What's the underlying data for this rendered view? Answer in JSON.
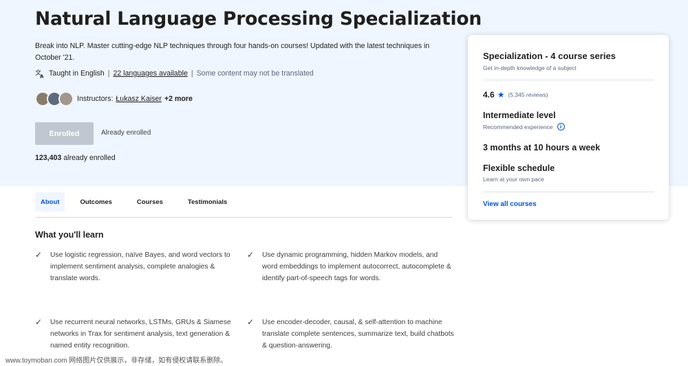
{
  "header": {
    "title": "Natural Language Processing Specialization",
    "description": "Break into NLP. Master cutting-edge NLP techniques through four hands-on courses! Updated with the latest techniques in October '21.",
    "taught_in": "Taught in English",
    "languages_link": "22 languages available",
    "translation_note": "Some content may not be translated",
    "instructors_label": "Instructors:",
    "instructor_name": "Łukasz Kaiser",
    "instructors_more": "+2 more",
    "enroll_button": "Enrolled",
    "enroll_status": "Already enrolled",
    "enrolled_count": "123,403",
    "enrolled_suffix": "already enrolled"
  },
  "card": {
    "series_title": "Specialization - 4 course series",
    "series_sub": "Get in-depth knowledge of a subject",
    "rating": "4.6",
    "reviews": "(5,345 reviews)",
    "level": "Intermediate level",
    "level_sub": "Recommended experience",
    "duration": "3 months at 10 hours a week",
    "schedule": "Flexible schedule",
    "schedule_sub": "Learn at your own pace",
    "view_all": "View all courses"
  },
  "tabs": [
    {
      "label": "About"
    },
    {
      "label": "Outcomes"
    },
    {
      "label": "Courses"
    },
    {
      "label": "Testimonials"
    }
  ],
  "learn": {
    "title": "What you'll learn",
    "items": [
      "Use logistic regression, naïve Bayes, and word vectors to implement sentiment analysis, complete analogies & translate words.",
      "Use dynamic programming, hidden Markov models, and word embeddings to implement autocorrect, autocomplete & identify part-of-speech tags for words.",
      "Use recurrent neural networks, LSTMs, GRUs & Siamese networks in Trax for sentiment analysis, text generation & named entity recognition.",
      "Use encoder-decoder, causal, & self-attention to machine translate complete sentences, summarize text, build chatbots & question-answering."
    ]
  },
  "watermark": "www.toymoban.com 网络图片仅供展示，非存储，如有侵权请联系删除。",
  "colors": {
    "hero_bg": "#f0f6ff",
    "accent": "#0056d2",
    "disabled_button": "#c1c7d0"
  },
  "icons": {
    "language": "translate-icon",
    "star": "star-icon",
    "info": "info-icon",
    "check": "check-icon"
  }
}
